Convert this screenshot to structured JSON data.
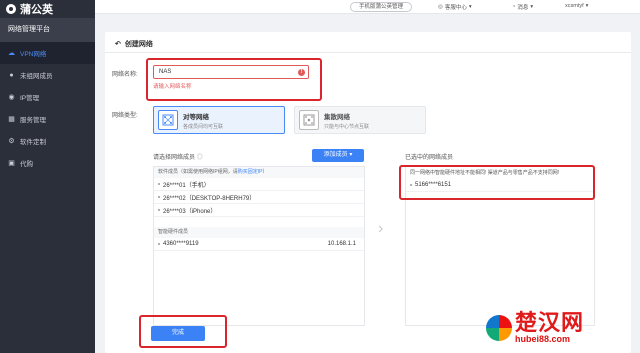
{
  "app": {
    "logo_text": "蒲公英"
  },
  "sidebar": {
    "title": "网络管理平台",
    "items": [
      {
        "label": "VPN网络",
        "icon": "cloud-icon",
        "active": true
      },
      {
        "label": "未组网成员",
        "icon": "user-icon",
        "active": false
      },
      {
        "label": "IP管理",
        "icon": "location-pin-icon",
        "active": false
      },
      {
        "label": "服务管理",
        "icon": "grid-icon",
        "active": false
      },
      {
        "label": "软件定制",
        "icon": "gear-icon",
        "active": false
      },
      {
        "label": "代购",
        "icon": "bag-icon",
        "active": false
      }
    ]
  },
  "topbar": {
    "mobile_btn": "手机版蒲公英管理",
    "support": "客服中心",
    "messages": "消息",
    "user": "xcsmtyf"
  },
  "page": {
    "title": "创建网络"
  },
  "form": {
    "name_label": "网络名称:",
    "name_value": "NAS",
    "name_error": "请输入网络名称",
    "type_label": "网络类型:",
    "types": [
      {
        "name": "对等网络",
        "desc": "各成员间均可互联"
      },
      {
        "name": "集散网络",
        "desc": "只能与中心节点互联"
      }
    ],
    "left_section": "请选择网络成员",
    "right_section": "已选中的网络成员",
    "add_button": "添加成员",
    "software_header": "软件成员（如需使用网络IP组网，请",
    "software_header_link": "购买固定IP",
    "software_header_end": "）",
    "software_members": [
      "26****01（手机）",
      "26****02（DESKTOP-8HERH79）",
      "26****03（iPhone）"
    ],
    "hardware_header": "智能硬件成员",
    "hardware_members": [
      {
        "name": "4360****9119",
        "ip": "10.168.1.1"
      }
    ],
    "right_warning": "同一网络中智能硬件地址不能相同! 渠道产品与零售产品不支持同网!",
    "selected_members": [
      "5166****6151"
    ],
    "done_button": "完成"
  },
  "watermark": {
    "cn": "楚汉网",
    "url": "hubei88.com"
  },
  "colors": {
    "accent": "#3b82f6",
    "error": "#e15a5a",
    "highlight": "#d9262c",
    "sidebar_bg": "#2b2f3a"
  }
}
